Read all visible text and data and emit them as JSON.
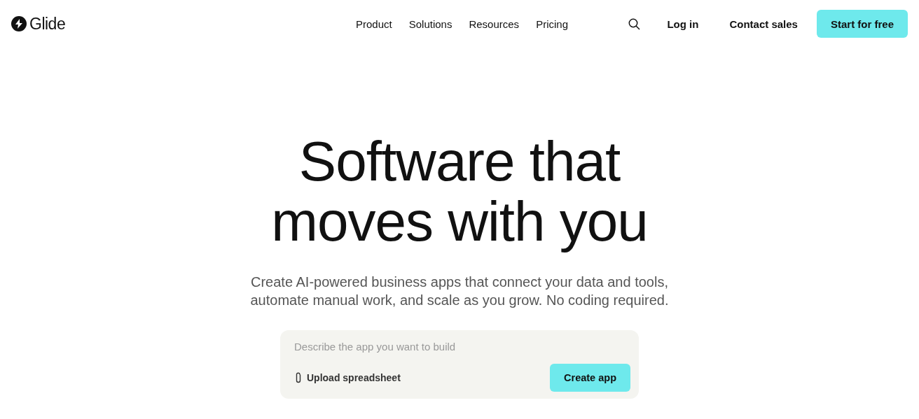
{
  "header": {
    "logo": "Glide",
    "nav": [
      "Product",
      "Solutions",
      "Resources",
      "Pricing"
    ],
    "login": "Log in",
    "contact": "Contact sales",
    "cta": "Start for free"
  },
  "hero": {
    "title_lines": [
      "Software that",
      "moves with you"
    ],
    "subtitle_lines": [
      "Create AI-powered business apps that connect your data and tools,",
      "automate manual work, and scale as you grow. No coding required."
    ]
  },
  "prompt": {
    "placeholder": "Describe the app you want to build",
    "upload": "Upload spreadsheet",
    "submit": "Create app"
  }
}
